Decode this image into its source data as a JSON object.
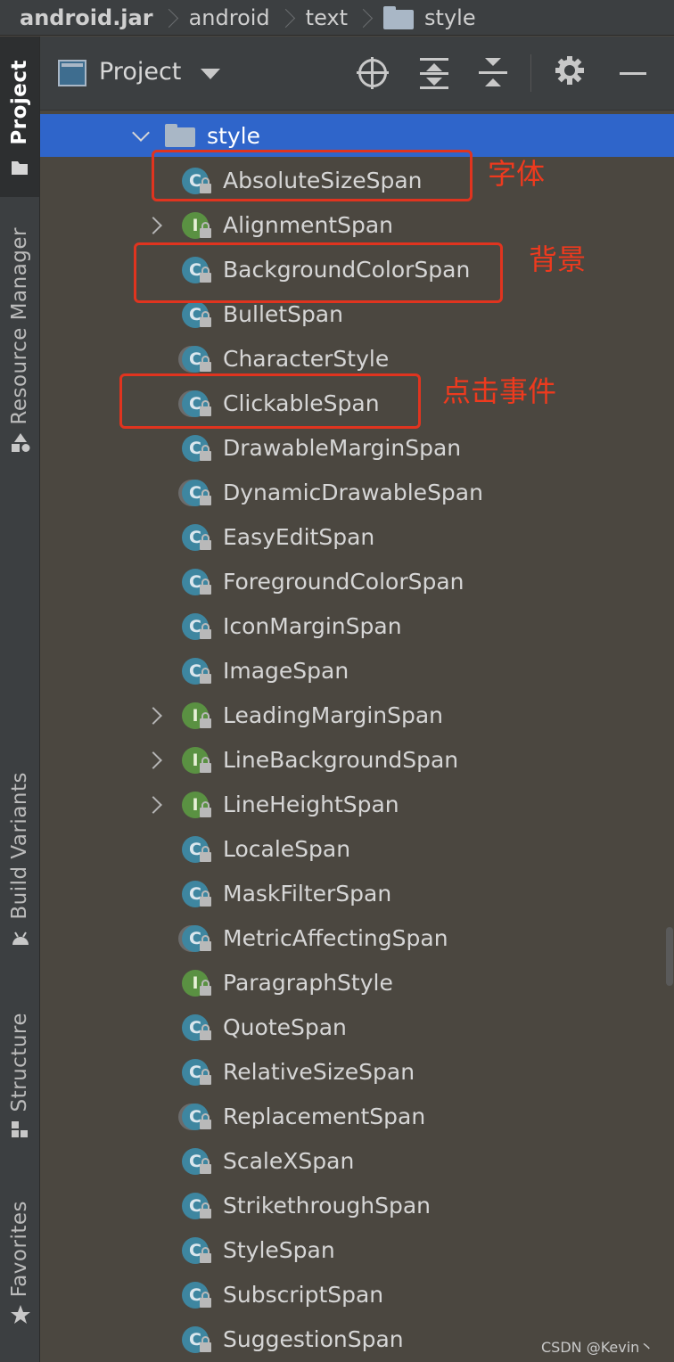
{
  "breadcrumb": [
    "android.jar",
    "android",
    "text",
    "style"
  ],
  "tool_windows": {
    "project": "Project",
    "resource_manager": "Resource Manager",
    "build_variants": "Build Variants",
    "structure": "Structure",
    "favorites": "Favorites"
  },
  "panel": {
    "view_label": "Project"
  },
  "tree": {
    "folder": "style",
    "items": [
      {
        "label": "AbsoluteSizeSpan",
        "kind": "class",
        "icon_letter": "C",
        "expandable": false
      },
      {
        "label": "AlignmentSpan",
        "kind": "interface",
        "icon_letter": "I",
        "expandable": true
      },
      {
        "label": "BackgroundColorSpan",
        "kind": "class",
        "icon_letter": "C",
        "expandable": false
      },
      {
        "label": "BulletSpan",
        "kind": "class",
        "icon_letter": "C",
        "expandable": false
      },
      {
        "label": "CharacterStyle",
        "kind": "abstract",
        "icon_letter": "C",
        "expandable": false
      },
      {
        "label": "ClickableSpan",
        "kind": "abstract",
        "icon_letter": "C",
        "expandable": false
      },
      {
        "label": "DrawableMarginSpan",
        "kind": "class",
        "icon_letter": "C",
        "expandable": false
      },
      {
        "label": "DynamicDrawableSpan",
        "kind": "abstract",
        "icon_letter": "C",
        "expandable": false
      },
      {
        "label": "EasyEditSpan",
        "kind": "class",
        "icon_letter": "C",
        "expandable": false
      },
      {
        "label": "ForegroundColorSpan",
        "kind": "class",
        "icon_letter": "C",
        "expandable": false
      },
      {
        "label": "IconMarginSpan",
        "kind": "class",
        "icon_letter": "C",
        "expandable": false
      },
      {
        "label": "ImageSpan",
        "kind": "class",
        "icon_letter": "C",
        "expandable": false
      },
      {
        "label": "LeadingMarginSpan",
        "kind": "interface",
        "icon_letter": "I",
        "expandable": true
      },
      {
        "label": "LineBackgroundSpan",
        "kind": "interface",
        "icon_letter": "I",
        "expandable": true
      },
      {
        "label": "LineHeightSpan",
        "kind": "interface",
        "icon_letter": "I",
        "expandable": true
      },
      {
        "label": "LocaleSpan",
        "kind": "class",
        "icon_letter": "C",
        "expandable": false
      },
      {
        "label": "MaskFilterSpan",
        "kind": "class",
        "icon_letter": "C",
        "expandable": false
      },
      {
        "label": "MetricAffectingSpan",
        "kind": "abstract",
        "icon_letter": "C",
        "expandable": false
      },
      {
        "label": "ParagraphStyle",
        "kind": "interface",
        "icon_letter": "I",
        "expandable": false
      },
      {
        "label": "QuoteSpan",
        "kind": "class",
        "icon_letter": "C",
        "expandable": false
      },
      {
        "label": "RelativeSizeSpan",
        "kind": "class",
        "icon_letter": "C",
        "expandable": false
      },
      {
        "label": "ReplacementSpan",
        "kind": "abstract",
        "icon_letter": "C",
        "expandable": false
      },
      {
        "label": "ScaleXSpan",
        "kind": "class",
        "icon_letter": "C",
        "expandable": false
      },
      {
        "label": "StrikethroughSpan",
        "kind": "class",
        "icon_letter": "C",
        "expandable": false
      },
      {
        "label": "StyleSpan",
        "kind": "class",
        "icon_letter": "C",
        "expandable": false
      },
      {
        "label": "SubscriptSpan",
        "kind": "class",
        "icon_letter": "C",
        "expandable": false
      },
      {
        "label": "SuggestionSpan",
        "kind": "class",
        "icon_letter": "C",
        "expandable": false
      }
    ]
  },
  "annotations": [
    {
      "item": "AbsoluteSizeSpan",
      "text": "字体"
    },
    {
      "item": "BackgroundColorSpan",
      "text": "背景"
    },
    {
      "item": "ClickableSpan",
      "text": "点击事件"
    }
  ],
  "watermark": "CSDN @Kevin丶",
  "colors": {
    "selection": "#2f65ca",
    "annotation": "#e0341f",
    "class_icon": "#3e86a0",
    "interface_icon": "#5a9142",
    "background": "#4b4740"
  }
}
